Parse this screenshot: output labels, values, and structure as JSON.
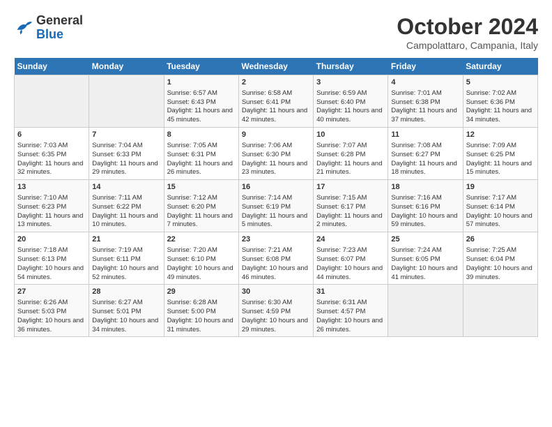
{
  "header": {
    "logo_general": "General",
    "logo_blue": "Blue",
    "month": "October 2024",
    "location": "Campolattaro, Campania, Italy"
  },
  "calendar": {
    "days_of_week": [
      "Sunday",
      "Monday",
      "Tuesday",
      "Wednesday",
      "Thursday",
      "Friday",
      "Saturday"
    ],
    "weeks": [
      [
        {
          "day": "",
          "sunrise": "",
          "sunset": "",
          "daylight": "",
          "empty": true
        },
        {
          "day": "",
          "sunrise": "",
          "sunset": "",
          "daylight": "",
          "empty": true
        },
        {
          "day": "1",
          "sunrise": "Sunrise: 6:57 AM",
          "sunset": "Sunset: 6:43 PM",
          "daylight": "Daylight: 11 hours and 45 minutes."
        },
        {
          "day": "2",
          "sunrise": "Sunrise: 6:58 AM",
          "sunset": "Sunset: 6:41 PM",
          "daylight": "Daylight: 11 hours and 42 minutes."
        },
        {
          "day": "3",
          "sunrise": "Sunrise: 6:59 AM",
          "sunset": "Sunset: 6:40 PM",
          "daylight": "Daylight: 11 hours and 40 minutes."
        },
        {
          "day": "4",
          "sunrise": "Sunrise: 7:01 AM",
          "sunset": "Sunset: 6:38 PM",
          "daylight": "Daylight: 11 hours and 37 minutes."
        },
        {
          "day": "5",
          "sunrise": "Sunrise: 7:02 AM",
          "sunset": "Sunset: 6:36 PM",
          "daylight": "Daylight: 11 hours and 34 minutes."
        }
      ],
      [
        {
          "day": "6",
          "sunrise": "Sunrise: 7:03 AM",
          "sunset": "Sunset: 6:35 PM",
          "daylight": "Daylight: 11 hours and 32 minutes."
        },
        {
          "day": "7",
          "sunrise": "Sunrise: 7:04 AM",
          "sunset": "Sunset: 6:33 PM",
          "daylight": "Daylight: 11 hours and 29 minutes."
        },
        {
          "day": "8",
          "sunrise": "Sunrise: 7:05 AM",
          "sunset": "Sunset: 6:31 PM",
          "daylight": "Daylight: 11 hours and 26 minutes."
        },
        {
          "day": "9",
          "sunrise": "Sunrise: 7:06 AM",
          "sunset": "Sunset: 6:30 PM",
          "daylight": "Daylight: 11 hours and 23 minutes."
        },
        {
          "day": "10",
          "sunrise": "Sunrise: 7:07 AM",
          "sunset": "Sunset: 6:28 PM",
          "daylight": "Daylight: 11 hours and 21 minutes."
        },
        {
          "day": "11",
          "sunrise": "Sunrise: 7:08 AM",
          "sunset": "Sunset: 6:27 PM",
          "daylight": "Daylight: 11 hours and 18 minutes."
        },
        {
          "day": "12",
          "sunrise": "Sunrise: 7:09 AM",
          "sunset": "Sunset: 6:25 PM",
          "daylight": "Daylight: 11 hours and 15 minutes."
        }
      ],
      [
        {
          "day": "13",
          "sunrise": "Sunrise: 7:10 AM",
          "sunset": "Sunset: 6:23 PM",
          "daylight": "Daylight: 11 hours and 13 minutes."
        },
        {
          "day": "14",
          "sunrise": "Sunrise: 7:11 AM",
          "sunset": "Sunset: 6:22 PM",
          "daylight": "Daylight: 11 hours and 10 minutes."
        },
        {
          "day": "15",
          "sunrise": "Sunrise: 7:12 AM",
          "sunset": "Sunset: 6:20 PM",
          "daylight": "Daylight: 11 hours and 7 minutes."
        },
        {
          "day": "16",
          "sunrise": "Sunrise: 7:14 AM",
          "sunset": "Sunset: 6:19 PM",
          "daylight": "Daylight: 11 hours and 5 minutes."
        },
        {
          "day": "17",
          "sunrise": "Sunrise: 7:15 AM",
          "sunset": "Sunset: 6:17 PM",
          "daylight": "Daylight: 11 hours and 2 minutes."
        },
        {
          "day": "18",
          "sunrise": "Sunrise: 7:16 AM",
          "sunset": "Sunset: 6:16 PM",
          "daylight": "Daylight: 10 hours and 59 minutes."
        },
        {
          "day": "19",
          "sunrise": "Sunrise: 7:17 AM",
          "sunset": "Sunset: 6:14 PM",
          "daylight": "Daylight: 10 hours and 57 minutes."
        }
      ],
      [
        {
          "day": "20",
          "sunrise": "Sunrise: 7:18 AM",
          "sunset": "Sunset: 6:13 PM",
          "daylight": "Daylight: 10 hours and 54 minutes."
        },
        {
          "day": "21",
          "sunrise": "Sunrise: 7:19 AM",
          "sunset": "Sunset: 6:11 PM",
          "daylight": "Daylight: 10 hours and 52 minutes."
        },
        {
          "day": "22",
          "sunrise": "Sunrise: 7:20 AM",
          "sunset": "Sunset: 6:10 PM",
          "daylight": "Daylight: 10 hours and 49 minutes."
        },
        {
          "day": "23",
          "sunrise": "Sunrise: 7:21 AM",
          "sunset": "Sunset: 6:08 PM",
          "daylight": "Daylight: 10 hours and 46 minutes."
        },
        {
          "day": "24",
          "sunrise": "Sunrise: 7:23 AM",
          "sunset": "Sunset: 6:07 PM",
          "daylight": "Daylight: 10 hours and 44 minutes."
        },
        {
          "day": "25",
          "sunrise": "Sunrise: 7:24 AM",
          "sunset": "Sunset: 6:05 PM",
          "daylight": "Daylight: 10 hours and 41 minutes."
        },
        {
          "day": "26",
          "sunrise": "Sunrise: 7:25 AM",
          "sunset": "Sunset: 6:04 PM",
          "daylight": "Daylight: 10 hours and 39 minutes."
        }
      ],
      [
        {
          "day": "27",
          "sunrise": "Sunrise: 6:26 AM",
          "sunset": "Sunset: 5:03 PM",
          "daylight": "Daylight: 10 hours and 36 minutes."
        },
        {
          "day": "28",
          "sunrise": "Sunrise: 6:27 AM",
          "sunset": "Sunset: 5:01 PM",
          "daylight": "Daylight: 10 hours and 34 minutes."
        },
        {
          "day": "29",
          "sunrise": "Sunrise: 6:28 AM",
          "sunset": "Sunset: 5:00 PM",
          "daylight": "Daylight: 10 hours and 31 minutes."
        },
        {
          "day": "30",
          "sunrise": "Sunrise: 6:30 AM",
          "sunset": "Sunset: 4:59 PM",
          "daylight": "Daylight: 10 hours and 29 minutes."
        },
        {
          "day": "31",
          "sunrise": "Sunrise: 6:31 AM",
          "sunset": "Sunset: 4:57 PM",
          "daylight": "Daylight: 10 hours and 26 minutes."
        },
        {
          "day": "",
          "sunrise": "",
          "sunset": "",
          "daylight": "",
          "empty": true
        },
        {
          "day": "",
          "sunrise": "",
          "sunset": "",
          "daylight": "",
          "empty": true
        }
      ]
    ]
  }
}
